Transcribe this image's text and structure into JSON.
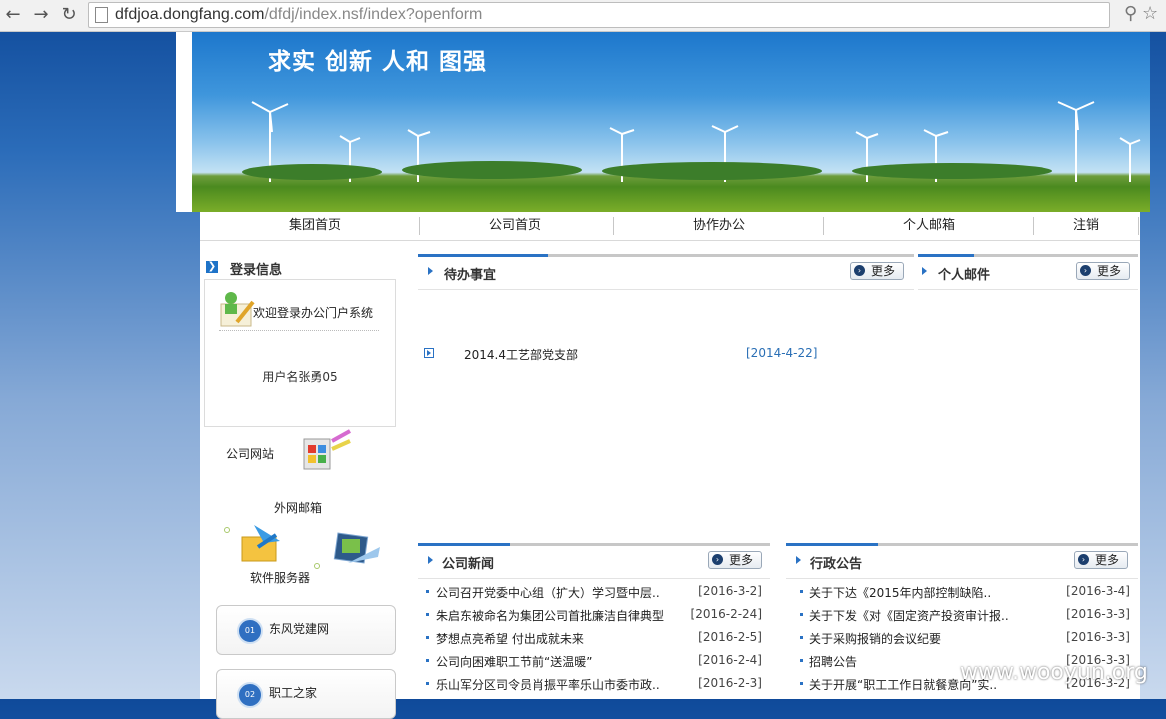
{
  "browser": {
    "url_domain": "dfdjoa.dongfang.com",
    "url_path": "/dfdj/index.nsf/index?openform",
    "back_icon": "back-arrow-icon",
    "forward_icon": "forward-arrow-icon",
    "reload_icon": "reload-icon"
  },
  "banner": {
    "slogan": "求实 创新  人和 图强"
  },
  "nav": {
    "items": [
      "集团首页",
      "公司首页",
      "协作办公",
      "个人邮箱",
      "注销"
    ]
  },
  "sidebar": {
    "login_title": "登录信息",
    "welcome": "欢迎登录办公门户系统",
    "username": "用户名张勇05",
    "quick_links": [
      "公司网站",
      "外网邮箱",
      "软件服务器"
    ],
    "portal_buttons": [
      {
        "num": "01",
        "label": "东风党建网"
      },
      {
        "num": "02",
        "label": "职工之家"
      }
    ]
  },
  "todo": {
    "title": "待办事宜",
    "more": "更多",
    "items": [
      {
        "title": "2014.4工艺部党支部",
        "date": "[2014-4-22]"
      }
    ]
  },
  "mail": {
    "title": "个人邮件",
    "more": "更多"
  },
  "news": {
    "title": "公司新闻",
    "more": "更多",
    "items": [
      {
        "title": "公司召开党委中心组（扩大）学习暨中层..",
        "date": "[2016-3-2]"
      },
      {
        "title": "朱启东被命名为集团公司首批廉洁自律典型",
        "date": "[2016-2-24]"
      },
      {
        "title": "梦想点亮希望 付出成就未来",
        "date": "[2016-2-5]"
      },
      {
        "title": "公司向困难职工节前“送温暖”",
        "date": "[2016-2-4]"
      },
      {
        "title": "乐山军分区司令员肖振平率乐山市委市政..",
        "date": "[2016-2-3]"
      }
    ]
  },
  "notice": {
    "title": "行政公告",
    "more": "更多",
    "items": [
      {
        "title": "关于下达《2015年内部控制缺陷..",
        "date": "[2016-3-4]"
      },
      {
        "title": "关于下发《对《固定资产投资审计报..",
        "date": "[2016-3-3]"
      },
      {
        "title": "关于采购报销的会议纪要",
        "date": "[2016-3-3]"
      },
      {
        "title": "招聘公告",
        "date": "[2016-3-3]"
      },
      {
        "title": "关于开展“职工工作日就餐意向”实..",
        "date": "[2016-3-2]"
      }
    ]
  },
  "watermark": "www.wooyun.org",
  "colors": {
    "accent": "#2a72c4",
    "page_bg_top": "#0f4a9a"
  }
}
